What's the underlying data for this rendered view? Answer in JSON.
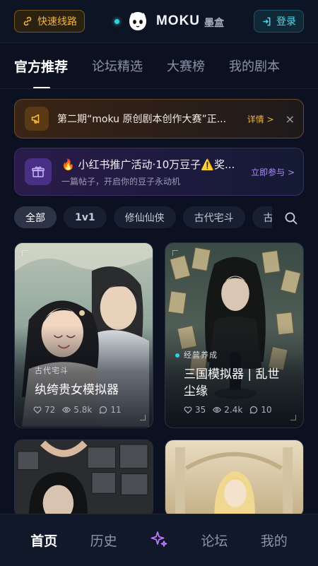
{
  "header": {
    "route_button": "快速线路",
    "brand_name": "MOKU",
    "brand_sub": "墨盒",
    "login": "登录"
  },
  "tabs": [
    {
      "label": "官方推荐",
      "active": true
    },
    {
      "label": "论坛精选",
      "active": false
    },
    {
      "label": "大赛榜",
      "active": false
    },
    {
      "label": "我的剧本",
      "active": false
    }
  ],
  "banner_contest": {
    "text": "第二期“moku 原创剧本创作大赛”正...",
    "detail": "详情 >",
    "close": "×",
    "icon": "megaphone-icon"
  },
  "banner_promo": {
    "title": "🔥 小红书推广活动·10万豆子⚠️奖...",
    "subtitle": "一篇帖子，开启你的豆子永动机",
    "action": "立即参与 >",
    "icon": "gift-icon"
  },
  "chips": [
    {
      "label": "全部",
      "active": true
    },
    {
      "label": "1v1",
      "active": false
    },
    {
      "label": "修仙仙侠",
      "active": false
    },
    {
      "label": "古代宅斗",
      "active": false
    },
    {
      "label": "古",
      "active": false
    }
  ],
  "cards": [
    {
      "tag": "古代宅斗",
      "title": "纨绔贵女模拟器",
      "likes": "72",
      "views": "5.8k",
      "comments": "11"
    },
    {
      "tag": "经营养成",
      "title_line1": "三国模拟器 | 乱世",
      "title_line2": "尘缘",
      "likes": "35",
      "views": "2.4k",
      "comments": "10"
    }
  ],
  "bottom_nav": {
    "home": "首页",
    "history": "历史",
    "create_icon": "sparkle-icon",
    "forum": "论坛",
    "mine": "我的"
  },
  "colors": {
    "background": "#0b1120",
    "accent_gold": "#f2b43a",
    "accent_cyan": "#4fd6ea",
    "accent_purple": "#a98cf4"
  }
}
